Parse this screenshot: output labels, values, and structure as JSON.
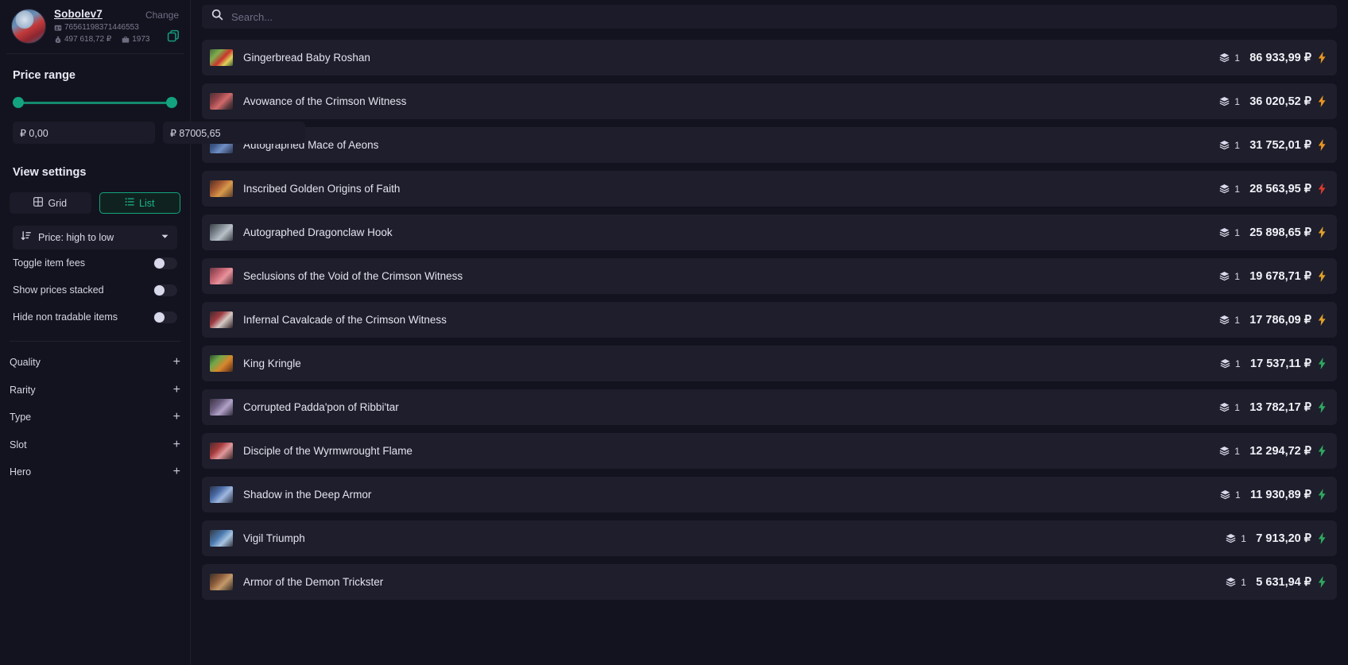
{
  "sidebar": {
    "profile": {
      "name": "Sobolev7",
      "change_label": "Change",
      "steam_id": "76561198371446553",
      "balance": "497 618,72 ₽",
      "inventory_count": "1973",
      "copy_icon": "copy-icon",
      "avatar_icon": "avatar"
    },
    "price_range": {
      "title": "Price range",
      "min_value": "₽ 0,00",
      "max_value": "₽ 87005,65",
      "min_placeholder": "₽ 0,00",
      "max_placeholder": "₽ 87005,65",
      "slider_min_pct": 0,
      "slider_max_pct": 100,
      "accent_color": "#13a37f"
    },
    "view_settings": {
      "title": "View settings",
      "grid_label": "Grid",
      "list_label": "List",
      "active_view": "List",
      "sort_label": "Price: high to low",
      "toggles": [
        {
          "label": "Toggle item fees",
          "on": false
        },
        {
          "label": "Show prices stacked",
          "on": false
        },
        {
          "label": "Hide non tradable items",
          "on": false
        }
      ]
    },
    "filters": [
      {
        "label": "Quality",
        "expand": "+"
      },
      {
        "label": "Rarity",
        "expand": "+"
      },
      {
        "label": "Type",
        "expand": "+"
      },
      {
        "label": "Slot",
        "expand": "+"
      },
      {
        "label": "Hero",
        "expand": "+"
      }
    ]
  },
  "main": {
    "search": {
      "placeholder": "Search...",
      "value": ""
    },
    "currency_symbol": "₽",
    "items": [
      {
        "name": "Gingerbread Baby Roshan",
        "count": "1",
        "price": "86 933,99 ₽",
        "bolt_color": "#e8951f",
        "thumb": "linear-gradient(135deg,#4a6b3a 0%,#7fae4e 30%,#c9352c 55%,#e0d15a 75%,#3f5a34 100%)"
      },
      {
        "name": "Avowance of the Crimson Witness",
        "count": "1",
        "price": "36 020,52 ₽",
        "bolt_color": "#e8951f",
        "thumb": "linear-gradient(135deg,#4b3236 0%,#8e4147 30%,#d16a6a 55%,#5d3a3e 80%,#2e2024 100%)"
      },
      {
        "name": "Autographed Mace of Aeons",
        "count": "1",
        "price": "31 752,01 ₽",
        "bolt_color": "#e8951f",
        "thumb": "linear-gradient(135deg,#27334d 0%,#3f5b8c 35%,#6f8fc4 60%,#2b3350 100%)"
      },
      {
        "name": "Inscribed Golden Origins of Faith",
        "count": "1",
        "price": "28 563,95 ₽",
        "bolt_color": "#d63a2e",
        "thumb": "linear-gradient(135deg,#4c2f24 0%,#a85a33 35%,#d89a4b 60%,#5a3a28 100%)"
      },
      {
        "name": "Autographed Dragonclaw Hook",
        "count": "1",
        "price": "25 898,65 ₽",
        "bolt_color": "#e0a02a",
        "thumb": "linear-gradient(135deg,#3b3f44 0%,#7e8790 35%,#b8c0c8 60%,#3a3e44 100%)"
      },
      {
        "name": "Seclusions of the Void of the Crimson Witness",
        "count": "1",
        "price": "19 678,71 ₽",
        "bolt_color": "#e0a02a",
        "thumb": "linear-gradient(135deg,#6b3a44 0%,#c0606e 35%,#e9939c 60%,#4a2a32 100%)"
      },
      {
        "name": "Infernal Cavalcade of the Crimson Witness",
        "count": "1",
        "price": "17 786,09 ₽",
        "bolt_color": "#e0a02a",
        "thumb": "linear-gradient(135deg,#3a2a2e 0%,#9e3a40 35%,#d6c9c4 60%,#2e2226 100%)"
      },
      {
        "name": "King Kringle",
        "count": "1",
        "price": "17 537,11 ₽",
        "bolt_color": "#2fa85f",
        "thumb": "linear-gradient(135deg,#2f4a2c 0%,#6ea84a 30%,#d8872c 60%,#8a4a1e 85%,#32301f 100%)"
      },
      {
        "name": "Corrupted Padda'pon of Ribbi'tar",
        "count": "1",
        "price": "13 782,17 ₽",
        "bolt_color": "#2fa85f",
        "thumb": "linear-gradient(135deg,#3a3344 0%,#6d5f82 35%,#b2a2c8 60%,#312b3c 100%)"
      },
      {
        "name": "Disciple of the Wyrmwrought Flame",
        "count": "1",
        "price": "12 294,72 ₽",
        "bolt_color": "#2fa85f",
        "thumb": "linear-gradient(135deg,#4a2a2c 0%,#a63a3c 35%,#e0989a 60%,#3a2426 100%)"
      },
      {
        "name": "Shadow in the Deep Armor",
        "count": "1",
        "price": "11 930,89 ₽",
        "bolt_color": "#2fa85f",
        "thumb": "linear-gradient(135deg,#2c3348 0%,#4a6ca8 35%,#9fb8e0 60%,#2a3044 100%)"
      },
      {
        "name": "Vigil Triumph",
        "count": "1",
        "price": "7 913,20 ₽",
        "bolt_color": "#2fa85f",
        "thumb": "linear-gradient(135deg,#32373f 0%,#4a7ab0 40%,#a8c4e2 65%,#30353d 100%)"
      },
      {
        "name": "Armor of the Demon Trickster",
        "count": "1",
        "price": "5 631,94 ₽",
        "bolt_color": "#2fa85f",
        "thumb": "linear-gradient(135deg,#3a2f2a 0%,#8a5a3a 35%,#c49a6a 60%,#322a26 100%)"
      }
    ]
  }
}
